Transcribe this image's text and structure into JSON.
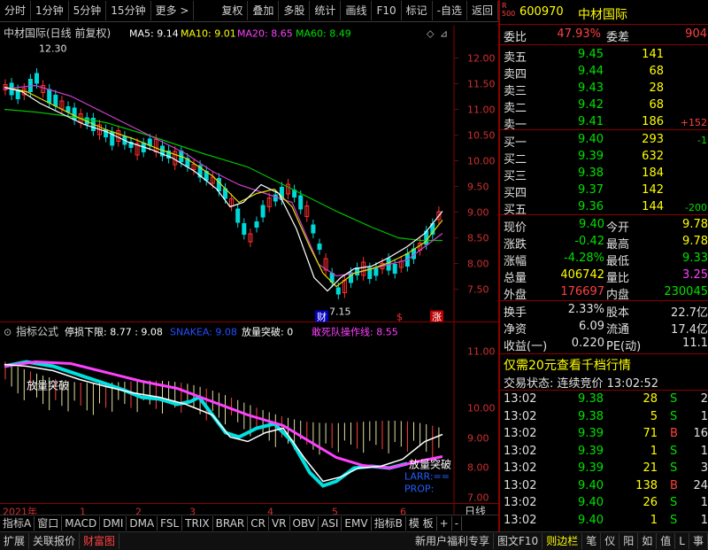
{
  "toolbar": {
    "periods": [
      "分时",
      "1分钟",
      "5分钟",
      "15分钟",
      "更多 >"
    ],
    "actions": [
      "复权",
      "叠加",
      "多股",
      "统计",
      "画线",
      "F10",
      "标记",
      "-自选",
      "返回"
    ]
  },
  "main_chart": {
    "title": "中材国际(日线 前复权)",
    "ma5": "MA5: 9.14",
    "ma10": "MA10: 9.01",
    "ma20": "MA20: 8.65",
    "ma60": "MA60: 8.49",
    "high_label": "12.30",
    "low_label": "7.15",
    "price_ticks": [
      "12.00",
      "11.50",
      "11.00",
      "10.50",
      "10.00",
      "9.50",
      "9.00",
      "8.50",
      "8.00",
      "7.50"
    ],
    "markers": [
      "财",
      "$",
      "涨"
    ]
  },
  "indicator_chart": {
    "label": "指标公式",
    "stoploss": "停损下限: 8.77 : 9.08",
    "snake": "SNAKEA: 9.08",
    "breakout": "放量突破: 0",
    "dare": "敢死队操作线: 8.55",
    "price_ticks": [
      "11.00",
      "10.00",
      "9.00",
      "8.00",
      "7.00"
    ],
    "text_breakout": "放量突破",
    "text_breakout2": "放量突破",
    "text_larr": "LARR:==",
    "text_prop": "PROP:"
  },
  "xaxis": {
    "labels": [
      "2021年",
      "1",
      "2",
      "3",
      "4",
      "5",
      "6"
    ],
    "period": "日线"
  },
  "bottom_tabs": [
    "指标A",
    "窗口",
    "MACD",
    "DMI",
    "DMA",
    "FSL",
    "TRIX",
    "BRAR",
    "CR",
    "VR",
    "OBV",
    "ASI",
    "EMV",
    "指标B",
    "模 板",
    "+",
    "-"
  ],
  "status_bar": {
    "left": [
      "扩展",
      "关联报价",
      "财富图"
    ],
    "right": [
      "新用户福利专享",
      "图文F10",
      "则边栏"
    ],
    "icons": [
      "笔",
      "仪",
      "阳",
      "如",
      "值",
      "L",
      "事"
    ]
  },
  "quote": {
    "code": "600970",
    "name": "中材国际",
    "weibi_label": "委比",
    "weibi": "47.93%",
    "weicha_label": "委差",
    "weicha": "904",
    "asks": [
      {
        "label": "卖五",
        "price": "9.45",
        "vol": "141",
        "chg": ""
      },
      {
        "label": "卖四",
        "price": "9.44",
        "vol": "68",
        "chg": ""
      },
      {
        "label": "卖三",
        "price": "9.43",
        "vol": "28",
        "chg": ""
      },
      {
        "label": "卖二",
        "price": "9.42",
        "vol": "68",
        "chg": ""
      },
      {
        "label": "卖一",
        "price": "9.41",
        "vol": "186",
        "chg": "+152"
      }
    ],
    "bids": [
      {
        "label": "买一",
        "price": "9.40",
        "vol": "293",
        "chg": "-1"
      },
      {
        "label": "买二",
        "price": "9.39",
        "vol": "632",
        "chg": ""
      },
      {
        "label": "买三",
        "price": "9.38",
        "vol": "184",
        "chg": ""
      },
      {
        "label": "买四",
        "price": "9.37",
        "vol": "142",
        "chg": ""
      },
      {
        "label": "买五",
        "price": "9.36",
        "vol": "144",
        "chg": "-200"
      }
    ],
    "stats": [
      {
        "l1": "现价",
        "v1": "9.40",
        "l2": "今开",
        "v2": "9.78"
      },
      {
        "l1": "涨跌",
        "v1": "-0.42",
        "l2": "最高",
        "v2": "9.78"
      },
      {
        "l1": "涨幅",
        "v1": "-4.28%",
        "l2": "最低",
        "v2": "9.33"
      },
      {
        "l1": "总量",
        "v1": "406742",
        "l2": "量比",
        "v2": "3.25"
      },
      {
        "l1": "外盘",
        "v1": "176697",
        "l2": "内盘",
        "v2": "230045"
      }
    ],
    "stats2": [
      {
        "l1": "换手",
        "v1": "2.33%",
        "l2": "股本",
        "v2": "22.7亿"
      },
      {
        "l1": "净资",
        "v1": "6.09",
        "l2": "流通",
        "v2": "17.4亿"
      },
      {
        "l1": "收益(一)",
        "v1": "0.220",
        "l2": "PE(动)",
        "v2": "11.1"
      }
    ],
    "promo": "仅需20元查看千档行情",
    "trade_status": "交易状态: 连续竞价 13:02:52",
    "ticks": [
      {
        "t": "13:02",
        "p": "9.38",
        "v": "28",
        "s": "S",
        "n": "2"
      },
      {
        "t": "13:02",
        "p": "9.38",
        "v": "5",
        "s": "S",
        "n": "1"
      },
      {
        "t": "13:02",
        "p": "9.39",
        "v": "71",
        "s": "B",
        "n": "16"
      },
      {
        "t": "13:02",
        "p": "9.39",
        "v": "1",
        "s": "S",
        "n": "1"
      },
      {
        "t": "13:02",
        "p": "9.39",
        "v": "21",
        "s": "S",
        "n": "3"
      },
      {
        "t": "13:02",
        "p": "9.40",
        "v": "138",
        "s": "B",
        "n": "24"
      },
      {
        "t": "13:02",
        "p": "9.40",
        "v": "26",
        "s": "S",
        "n": "1"
      },
      {
        "t": "13:02",
        "p": "9.40",
        "v": "1",
        "s": "S",
        "n": "1"
      }
    ]
  }
}
